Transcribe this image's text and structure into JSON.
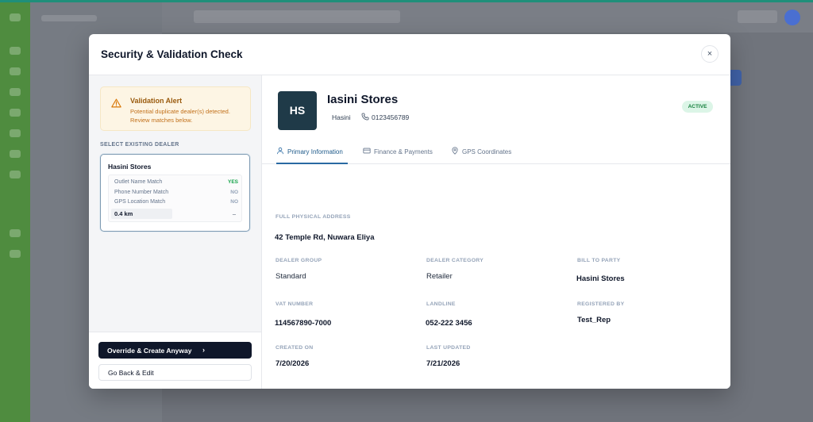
{
  "modal": {
    "title": "Security & Validation Check",
    "close_label": "×"
  },
  "alert": {
    "icon": "warning-triangle-icon",
    "title": "Validation Alert",
    "message": "Potential duplicate dealer(s) detected. Review matches below."
  },
  "existing": {
    "section_label": "SELECT EXISTING DEALER",
    "dealer_name": "Hasini Stores",
    "matches": [
      {
        "label": "Outlet Name Match",
        "value": "YES"
      },
      {
        "label": "Phone Number Match",
        "value": "NO"
      },
      {
        "label": "GPS Location Match",
        "value": "NO"
      }
    ],
    "distance": "0.4 km",
    "distance_extra": "–"
  },
  "actions": {
    "override_label": "Override & Create Anyway",
    "override_icon": "chevron-right-icon",
    "back_label": "Go Back & Edit"
  },
  "dealer": {
    "initials": "HS",
    "name": "Iasini Stores",
    "owner": "Hasini",
    "phone": "0123456789",
    "status": "ACTIVE",
    "status_color": "#15803d"
  },
  "tabs": [
    {
      "label": "Primary Information",
      "icon": "user-icon",
      "active": true
    },
    {
      "label": "Finance & Payments",
      "icon": "credit-card-icon",
      "active": false
    },
    {
      "label": "GPS Coordinates",
      "icon": "map-pin-icon",
      "active": false
    }
  ],
  "fields": {
    "address_label": "FULL PHYSICAL ADDRESS",
    "address": "42 Temple Rd, Nuwara Eliya",
    "dealer_group_label": "DEALER GROUP",
    "dealer_group": "Standard",
    "dealer_category_label": "DEALER CATEGORY",
    "dealer_category": "Retailer",
    "bill_to_label": "BILL TO PARTY",
    "bill_to": "Hasini Stores",
    "vat_label": "VAT NUMBER",
    "vat": "114567890-7000",
    "landline_label": "LANDLINE",
    "landline": "052-222 3456",
    "registered_by_label": "REGISTERED BY",
    "registered_by": "Test_Rep",
    "created_on_label": "CREATED ON",
    "created_on": "7/20/2026",
    "last_updated_label": "LAST UPDATED",
    "last_updated": "7/21/2026"
  },
  "colors": {
    "accent": "#2a6aa3",
    "primary_button": "#0f172a",
    "avatar_bg": "#1f3a48",
    "alert_bg": "#fdf5e4"
  }
}
